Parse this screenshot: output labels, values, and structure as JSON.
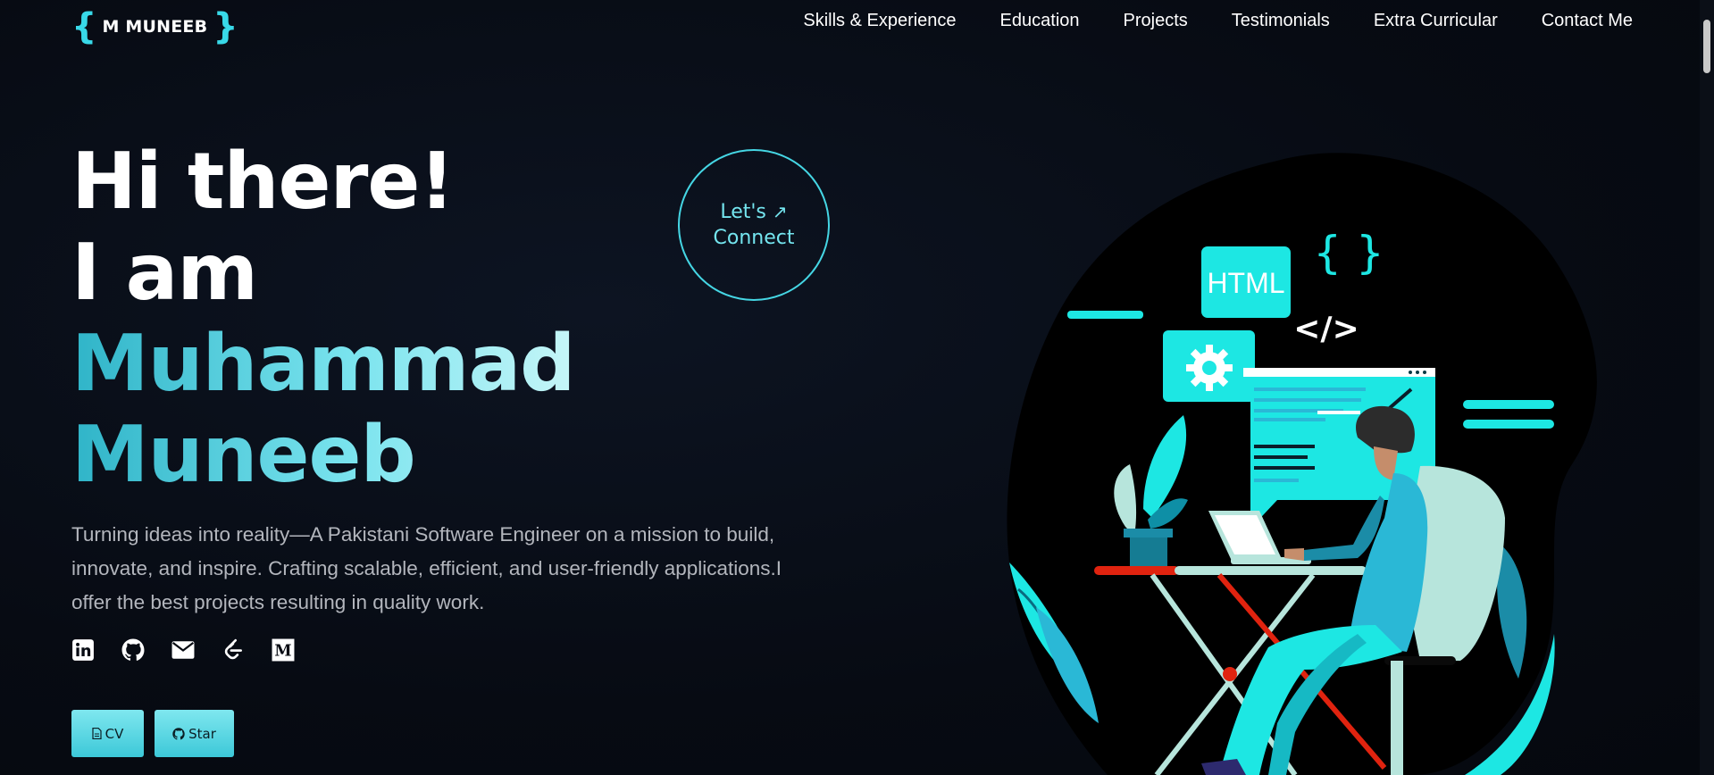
{
  "header": {
    "logo_open": "{",
    "logo_text": "M MUNEEB",
    "logo_close": "}",
    "nav": [
      "Skills & Experience",
      "Education",
      "Projects",
      "Testimonials",
      "Extra Curricular",
      "Contact Me"
    ]
  },
  "hero": {
    "line1": "Hi there!",
    "line2": "I am",
    "name1": "Muhammad",
    "name2": "Muneeb",
    "intro": "Turning ideas into reality—A Pakistani Software Engineer on a mission to build, innovate, and inspire. Crafting scalable, efficient, and user-friendly applications.I offer the best projects resulting in quality work.",
    "connect_line1": "Let's",
    "connect_arrow": "↗",
    "connect_line2": "Connect",
    "cv_label": "CV",
    "star_label": "Star"
  },
  "illustration": {
    "html_tag": "HTML",
    "code_symbol": "</>",
    "braces": "{  }"
  },
  "icons": [
    "linkedin-icon",
    "github-icon",
    "mail-icon",
    "leetcode-icon",
    "medium-icon"
  ],
  "colors": {
    "accent": "#38d9e8",
    "background": "#070b13",
    "button": "#5dd8e6"
  }
}
